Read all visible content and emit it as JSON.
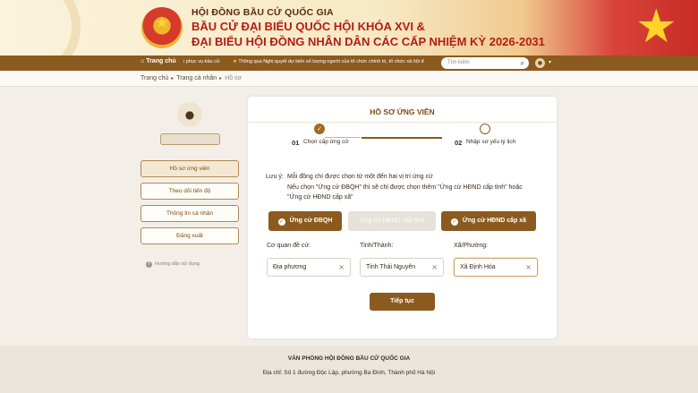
{
  "header": {
    "council": "HỘI ĐỒNG BẦU CỬ QUỐC GIA",
    "line1": "BẦU CỬ ĐẠI BIỂU QUỐC HỘI KHÓA XVI &",
    "line2": "ĐẠI BIỂU HỘI ĐỒNG NHÂN DÂN CÁC CẤP NHIỆM KỲ 2026-2031"
  },
  "nav": {
    "home": "Trang chủ",
    "item1": "i phục vụ bầu cử",
    "item2": "Thông qua Nghị quyết dự kiến số lượng người của tổ chức chính trị, tổ chức xã hội đ",
    "search_placeholder": "Tìm kiếm"
  },
  "breadcrumb": {
    "home": "Trang chủ",
    "personal": "Trang cá nhân",
    "current": "Hồ sơ"
  },
  "sidebar": {
    "items": [
      {
        "label": "Hồ sơ ứng viên"
      },
      {
        "label": "Theo dõi tiến độ"
      },
      {
        "label": "Thông tin cá nhân"
      },
      {
        "label": "Đăng xuất"
      }
    ],
    "help": "Hướng dẫn sử dụng"
  },
  "card": {
    "title": "HỒ SƠ ỨNG VIÊN",
    "steps": [
      {
        "num": "01",
        "label": "Chọn cấp ứng cử",
        "done": true
      },
      {
        "num": "02",
        "label": "Nhập sơ yếu lý lịch",
        "done": false
      }
    ],
    "note_label": "Lưu ý:",
    "note_1": "Mỗi đồng chí được chọn từ một đến hai vị trí ứng cử",
    "note_2": "Nếu chọn \"Ứng cử ĐBQH\" thì sẽ chỉ được chọn thêm \"Ứng cử HĐND cấp tỉnh\" hoặc",
    "note_3": "\"Ứng cử HĐND cấp xã\"",
    "options": [
      {
        "label": "Ứng cử ĐBQH",
        "state": "selected"
      },
      {
        "label": "Ứng cử HĐND cấp tỉnh",
        "state": "disabled"
      },
      {
        "label": "Ứng cử HĐND cấp xã",
        "state": "selected"
      }
    ],
    "fields": [
      {
        "label": "Cơ quan đề cử:",
        "value": "Địa phương"
      },
      {
        "label": "Tỉnh/Thành:",
        "value": "Tỉnh Thái Nguyên"
      },
      {
        "label": "Xã/Phường:",
        "value": "Xã Định Hóa"
      }
    ],
    "next_label": "Tiếp tục"
  },
  "footer": {
    "office": "VĂN PHÒNG HỘI ĐỒNG BẦU CỬ QUỐC GIA",
    "address": "Địa chỉ: Số 1 đường Độc Lập, phường Ba Đình, Thành phố Hà Nội"
  },
  "colors": {
    "brand": "#8b5a1e",
    "title_red": "#b41c14",
    "disabled": "#e6e1d9"
  },
  "icons": {
    "home": "home-icon",
    "search": "search-icon",
    "user": "user-icon",
    "check": "check-icon",
    "clear": "clear-icon",
    "help": "help-icon"
  }
}
